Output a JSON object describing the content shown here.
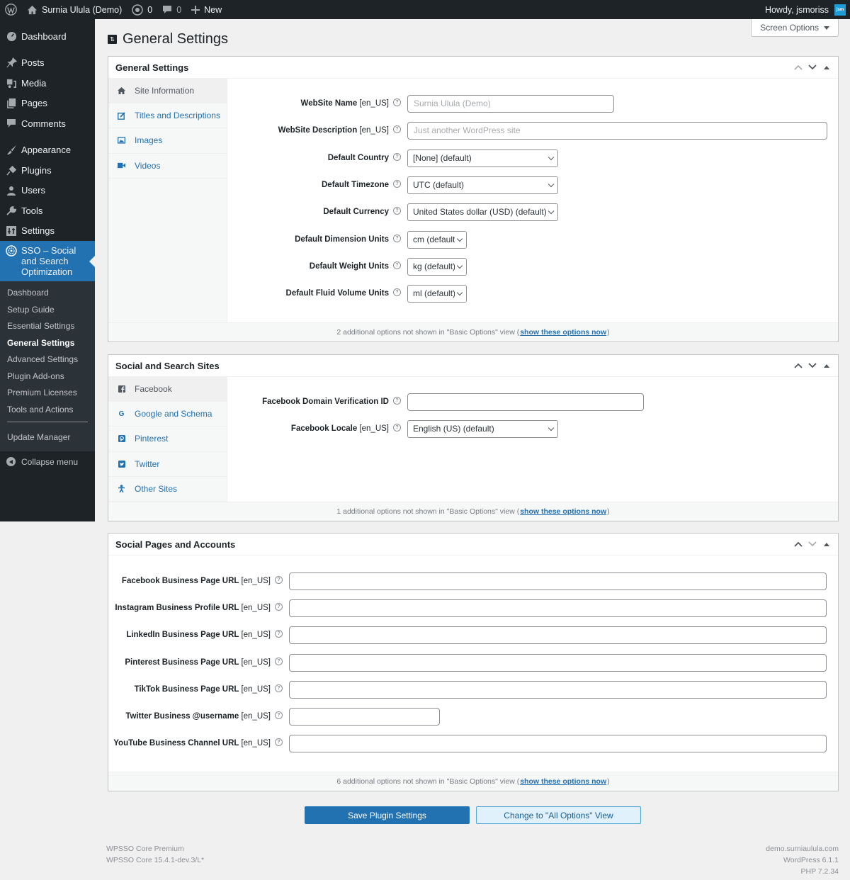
{
  "adminbar": {
    "site_name": "Surnia Ulula (Demo)",
    "updates_count": "0",
    "comments_count": "0",
    "new_label": "New",
    "howdy": "Howdy, jsmoriss",
    "avatar_text": "jsm"
  },
  "sidebar": {
    "items": [
      {
        "label": "Dashboard",
        "icon": "dashboard-icon"
      },
      {
        "label": "Posts",
        "icon": "pin-icon"
      },
      {
        "label": "Media",
        "icon": "media-icon"
      },
      {
        "label": "Pages",
        "icon": "pages-icon"
      },
      {
        "label": "Comments",
        "icon": "comment-icon"
      },
      {
        "label": "Appearance",
        "icon": "brush-icon"
      },
      {
        "label": "Plugins",
        "icon": "plug-icon"
      },
      {
        "label": "Users",
        "icon": "user-icon"
      },
      {
        "label": "Tools",
        "icon": "wrench-icon"
      },
      {
        "label": "Settings",
        "icon": "settings-icon"
      },
      {
        "label": "SSO – Social and Search Optimization",
        "icon": "sso-icon"
      }
    ],
    "submenu": [
      {
        "label": "Dashboard"
      },
      {
        "label": "Setup Guide"
      },
      {
        "label": "Essential Settings"
      },
      {
        "label": "General Settings",
        "current": true
      },
      {
        "label": "Advanced Settings"
      },
      {
        "label": "Plugin Add-ons"
      },
      {
        "label": "Premium Licenses"
      },
      {
        "label": "Tools and Actions"
      },
      {
        "label": "Update Manager"
      }
    ],
    "collapse_label": "Collapse menu"
  },
  "page": {
    "title": "General Settings",
    "screen_options": "Screen Options"
  },
  "boxes": {
    "general": {
      "title": "General Settings",
      "tabs": [
        "Site Information",
        "Titles and Descriptions",
        "Images",
        "Videos"
      ],
      "fields": [
        {
          "label": "WebSite Name",
          "locale": "[en_US]",
          "type": "text",
          "placeholder": "Surnia Ulula (Demo)"
        },
        {
          "label": "WebSite Description",
          "locale": "[en_US]",
          "type": "text",
          "placeholder": "Just another WordPress site"
        },
        {
          "label": "Default Country",
          "locale": "",
          "type": "select",
          "value": "[None] (default)"
        },
        {
          "label": "Default Timezone",
          "locale": "",
          "type": "select",
          "value": "UTC (default)"
        },
        {
          "label": "Default Currency",
          "locale": "",
          "type": "select",
          "value": "United States dollar (USD) (default)"
        },
        {
          "label": "Default Dimension Units",
          "locale": "",
          "type": "select",
          "value": "cm (default)"
        },
        {
          "label": "Default Weight Units",
          "locale": "",
          "type": "select",
          "value": "kg (default)"
        },
        {
          "label": "Default Fluid Volume Units",
          "locale": "",
          "type": "select",
          "value": "ml (default)"
        }
      ],
      "footer_text": "2 additional options not shown in \"Basic Options\" view (",
      "footer_link": "show these options now",
      "footer_end": ")"
    },
    "social": {
      "title": "Social and Search Sites",
      "tabs": [
        "Facebook",
        "Google and Schema",
        "Pinterest",
        "Twitter",
        "Other Sites"
      ],
      "fields": [
        {
          "label": "Facebook Domain Verification ID",
          "locale": "",
          "type": "text",
          "placeholder": ""
        },
        {
          "label": "Facebook Locale",
          "locale": "[en_US]",
          "type": "select",
          "value": "English (US) (default)"
        }
      ],
      "footer_text": "1 additional options not shown in \"Basic Options\" view (",
      "footer_link": "show these options now",
      "footer_end": ")"
    },
    "pages": {
      "title": "Social Pages and Accounts",
      "fields": [
        {
          "label": "Facebook Business Page URL",
          "locale": "[en_US]",
          "value": ""
        },
        {
          "label": "Instagram Business Profile URL",
          "locale": "[en_US]",
          "value": ""
        },
        {
          "label": "LinkedIn Business Page URL",
          "locale": "[en_US]",
          "value": ""
        },
        {
          "label": "Pinterest Business Page URL",
          "locale": "[en_US]",
          "value": ""
        },
        {
          "label": "TikTok Business Page URL",
          "locale": "[en_US]",
          "value": ""
        },
        {
          "label": "Twitter Business @username",
          "locale": "[en_US]",
          "value": ""
        },
        {
          "label": "YouTube Business Channel URL",
          "locale": "[en_US]",
          "value": ""
        }
      ],
      "footer_text": "6 additional options not shown in \"Basic Options\" view (",
      "footer_link": "show these options now",
      "footer_end": ")"
    }
  },
  "buttons": {
    "save": "Save Plugin Settings",
    "change_view": "Change to \"All Options\" View"
  },
  "footer": {
    "left_line1": "WPSSO Core Premium",
    "left_line2": "WPSSO Core 15.4.1-dev.3/L*",
    "right_line1": "demo.surniaulula.com",
    "right_line2": "WordPress 6.1.1",
    "right_line3": "PHP 7.2.34"
  },
  "help_glyph": "?"
}
